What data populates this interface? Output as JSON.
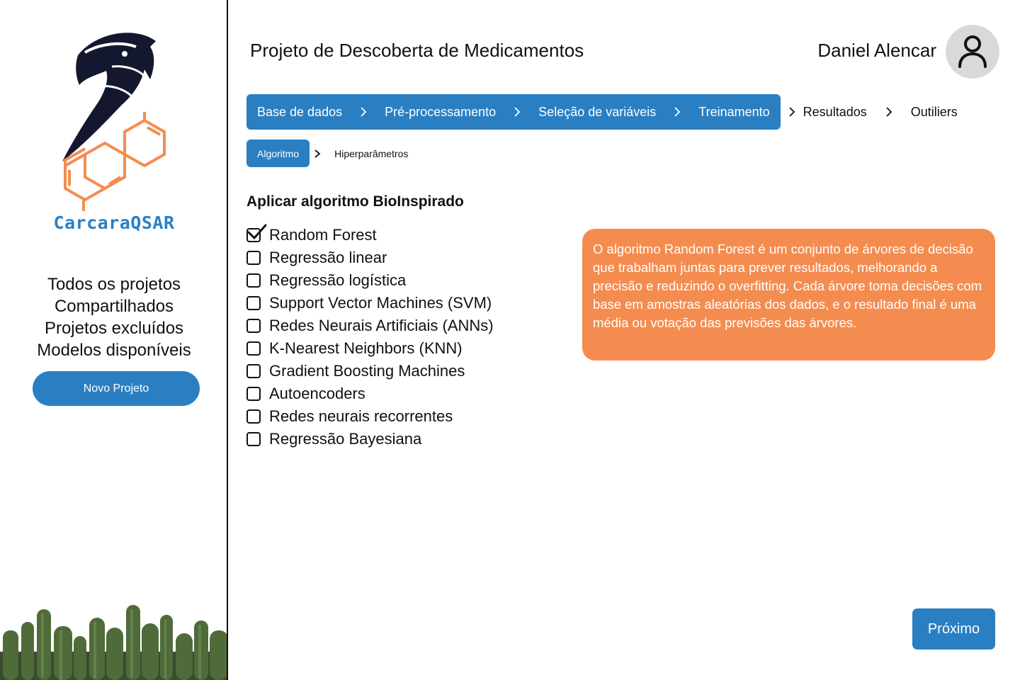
{
  "brand": {
    "name": "CarcaraQSAR"
  },
  "sidebar": {
    "items": [
      {
        "label": "Todos os projetos"
      },
      {
        "label": "Compartilhados"
      },
      {
        "label": "Projetos excluídos"
      },
      {
        "label": "Modelos disponíveis"
      }
    ],
    "new_project_label": "Novo Projeto"
  },
  "header": {
    "title": "Projeto de Descoberta de Medicamentos",
    "user_name": "Daniel Alencar",
    "avatar_icon": "user-icon"
  },
  "stepper": {
    "active_steps": [
      "Base de dados",
      "Pré-processamento",
      "Seleção de variáveis",
      "Treinamento"
    ],
    "remaining_steps": [
      "Resultados",
      "Outiliers"
    ]
  },
  "substepper": {
    "active": "Algoritmo",
    "next": "Hiperparâmetros"
  },
  "section": {
    "title": "Aplicar algoritmo BioInspirado",
    "algorithms": [
      {
        "label": "Random Forest",
        "checked": true
      },
      {
        "label": "Regressão linear",
        "checked": false
      },
      {
        "label": "Regressão logística",
        "checked": false
      },
      {
        "label": "Support Vector Machines (SVM)",
        "checked": false
      },
      {
        "label": "Redes Neurais Artificiais (ANNs)",
        "checked": false
      },
      {
        "label": "K-Nearest Neighbors (KNN)",
        "checked": false
      },
      {
        "label": "Gradient Boosting Machines",
        "checked": false
      },
      {
        "label": "Autoencoders",
        "checked": false
      },
      {
        "label": "Redes neurais recorrentes",
        "checked": false
      },
      {
        "label": "Regressão Bayesiana",
        "checked": false
      }
    ]
  },
  "info": {
    "text": "O algoritmo Random Forest é um conjunto de árvores de decisão que trabalham juntas para prever resultados, melhorando a precisão e reduzindo o overfitting. Cada árvore toma decisões com base em amostras aleatórias dos dados, e o resultado final é uma média ou votação das previsões das árvores."
  },
  "footer": {
    "next_label": "Próximo"
  },
  "colors": {
    "primary": "#2a7fc2",
    "accent": "#f58c4f",
    "logo_dark": "#14182e",
    "logo_orange": "#f58c4f"
  }
}
